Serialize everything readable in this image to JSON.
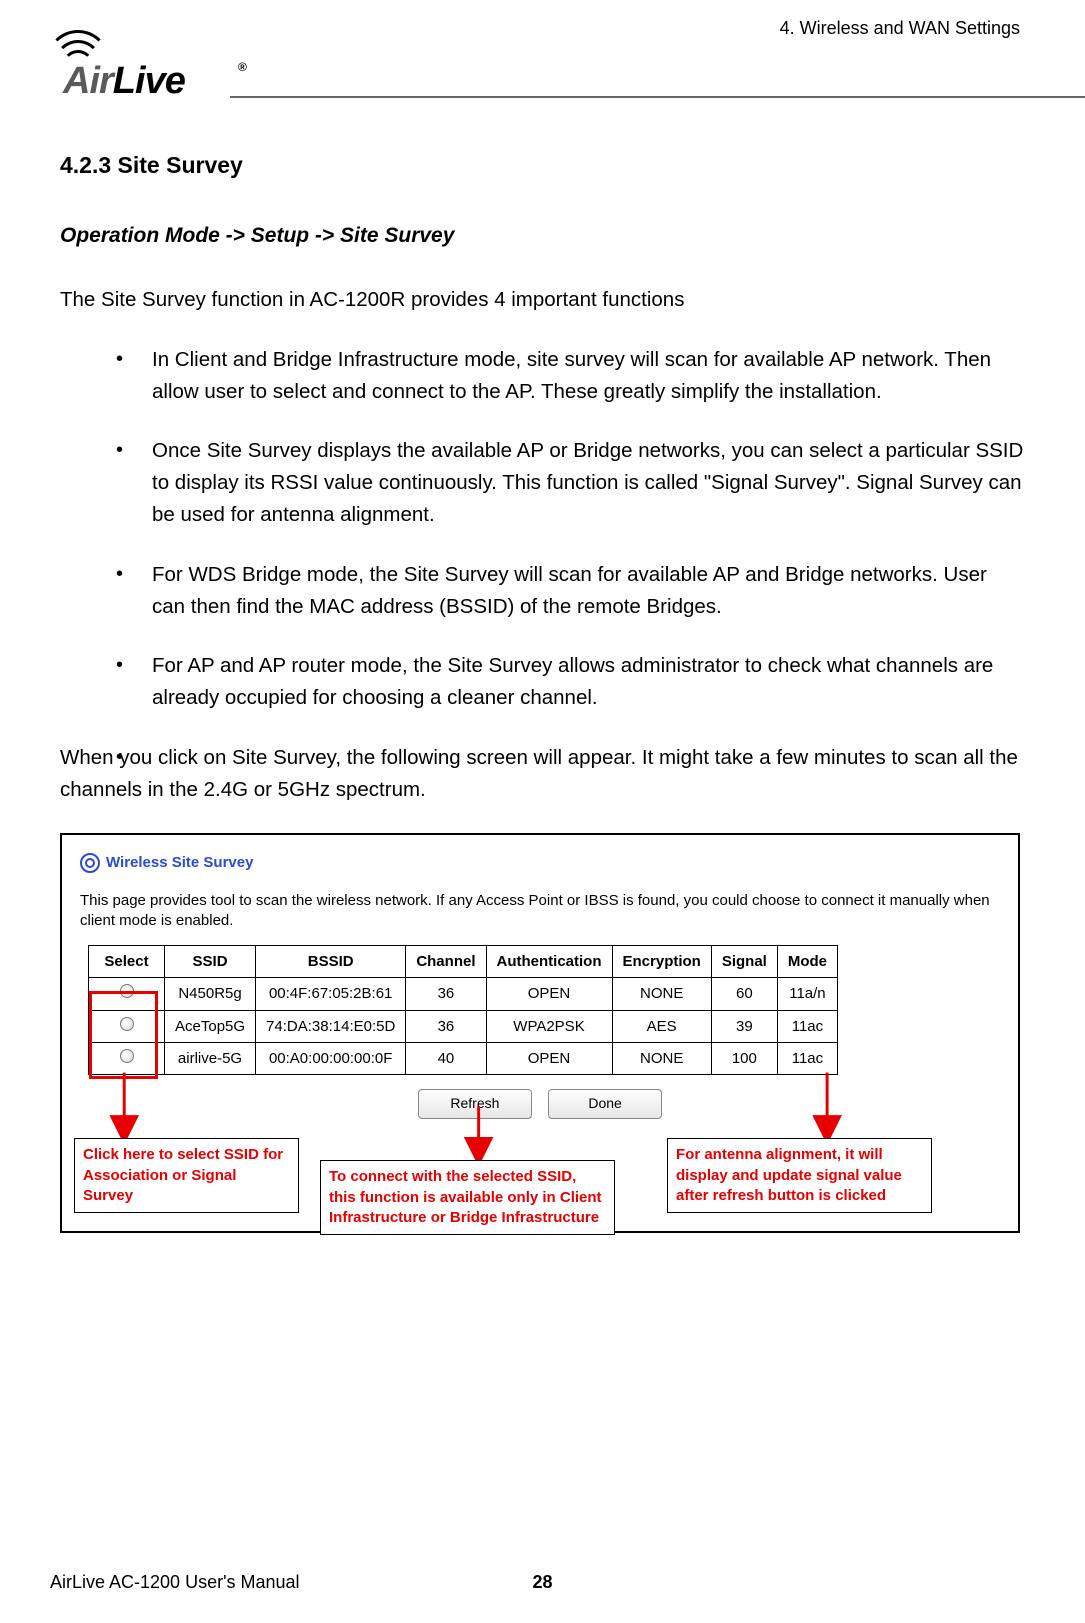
{
  "header": {
    "chapter": "4. Wireless and WAN Settings",
    "logo_air": "Air",
    "logo_live": "Live",
    "logo_reg": "®"
  },
  "section": {
    "number_title": "4.2.3 Site Survey",
    "breadcrumb": "Operation Mode -> Setup -> Site Survey",
    "intro": "The Site Survey function in AC-1200R provides 4 important functions",
    "bullets": [
      "In Client and Bridge Infrastructure mode, site survey will scan for available AP network. Then allow user to select and connect to the AP. These greatly simplify the installation.",
      "Once Site Survey displays the available AP or Bridge networks, you can select a particular SSID to display its RSSI value continuously. This function is called \"Signal Survey\". Signal Survey can be used for antenna alignment.",
      "For WDS Bridge mode, the Site Survey will scan for available AP and Bridge networks. User can then find the MAC address (BSSID) of the remote Bridges.",
      "For AP and AP router mode, the Site Survey allows administrator to check what channels are already occupied for choosing a cleaner channel."
    ],
    "post_bullets": "When you click on Site Survey, the following screen will appear. It might take a few minutes to scan all the channels in the 2.4G or 5GHz spectrum."
  },
  "screenshot": {
    "title": "Wireless Site Survey",
    "desc": "This page provides tool to scan the wireless network. If any Access Point or IBSS is found, you could choose to connect it manually when client mode is enabled.",
    "columns": [
      "Select",
      "SSID",
      "BSSID",
      "Channel",
      "Authentication",
      "Encryption",
      "Signal",
      "Mode"
    ],
    "rows": [
      {
        "ssid": "N450R5g",
        "bssid": "00:4F:67:05:2B:61",
        "channel": "36",
        "auth": "OPEN",
        "enc": "NONE",
        "signal": "60",
        "mode": "11a/n"
      },
      {
        "ssid": "AceTop5G",
        "bssid": "74:DA:38:14:E0:5D",
        "channel": "36",
        "auth": "WPA2PSK",
        "enc": "AES",
        "signal": "39",
        "mode": "11ac"
      },
      {
        "ssid": "airlive-5G",
        "bssid": "00:A0:00:00:00:0F",
        "channel": "40",
        "auth": "OPEN",
        "enc": "NONE",
        "signal": "100",
        "mode": "11ac"
      }
    ],
    "buttons": {
      "refresh": "Refresh",
      "done": "Done"
    }
  },
  "callouts": {
    "c1": "Click here to select SSID for Association or Signal Survey",
    "c2": "To connect with the selected SSID, this function is available only in Client Infrastructure or Bridge Infrastructure",
    "c3": "For antenna alignment, it will display and update signal value after refresh button is clicked"
  },
  "footer": {
    "manual": "AirLive AC-1200 User's Manual",
    "page": "28"
  }
}
